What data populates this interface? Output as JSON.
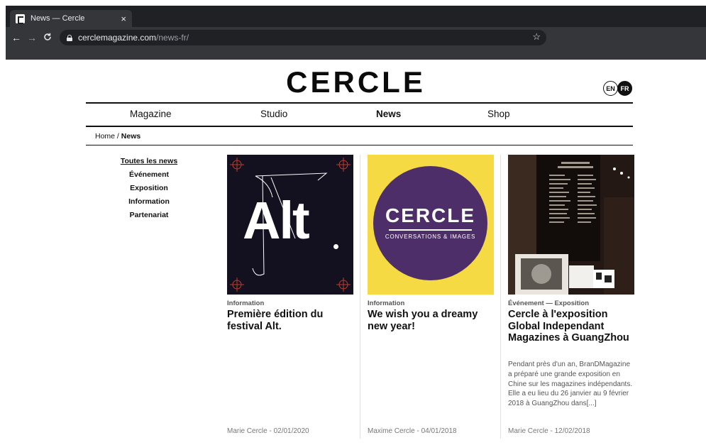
{
  "browser": {
    "tab_title": "News — Cercle",
    "tab_close": "×",
    "back": "←",
    "forward": "→",
    "reload": "C",
    "url_domain": "cerclemagazine.com",
    "url_path": "/news-fr/",
    "star": "☆"
  },
  "site": {
    "logo": "CERCLE",
    "lang_en": "EN",
    "lang_fr": "FR",
    "nav": [
      "Magazine",
      "Studio",
      "News",
      "Shop"
    ],
    "nav_active": "News"
  },
  "breadcrumb": {
    "home": "Home",
    "separator": " / ",
    "current": "News"
  },
  "filters": [
    "Toutes les news",
    "Événement",
    "Exposition",
    "Information",
    "Partenariat"
  ],
  "cards": [
    {
      "category": "Information",
      "title": "Première édition du festival Alt.",
      "excerpt": "",
      "author_date": "Marie Cercle - 02/01/2020",
      "thumb_text": "Alt"
    },
    {
      "category": "Information",
      "title": "We wish you a dreamy new year!",
      "excerpt": "",
      "author_date": "Maxime Cercle - 04/01/2018",
      "thumb_title": "CERCLE",
      "thumb_subtitle": "CONVERSATIONS & IMAGES"
    },
    {
      "category": "Événement",
      "category_separator": "—",
      "category_2": "Exposition",
      "title": "Cercle à l'exposition Global Independant Magazines à GuangZhou",
      "excerpt": "Pendant près d'un an, BranDMagazine a préparé une grande exposition en Chine sur les magazines indépendants. Elle a eu lieu du 26 janvier au 9 février 2018 à GuangZhou dans[...]",
      "author_date": "Marie Cercle - 12/02/2018"
    }
  ],
  "colors": {
    "chrome_dark": "#202124",
    "chrome_toolbar": "#35363a",
    "thumb_alt_bg": "#13111f",
    "thumb_alt_accent": "#c0392b",
    "thumb_cercle_yellow": "#f5da43",
    "thumb_cercle_purple": "#4e2e68"
  }
}
